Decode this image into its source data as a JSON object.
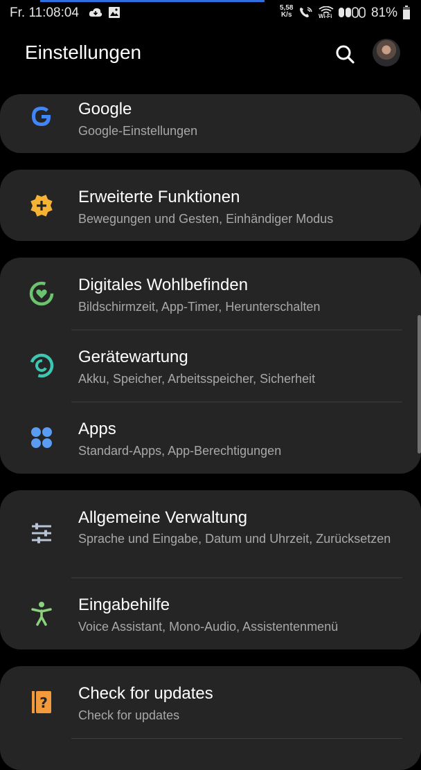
{
  "status_bar": {
    "time": "Fr. 11:08:04",
    "net_speed_value": "5,58",
    "net_speed_unit": "K/s",
    "wifi_label": "Wi-Fi",
    "battery": "81%"
  },
  "header": {
    "title": "Einstellungen"
  },
  "items": [
    {
      "title": "Google",
      "subtitle": "Google-Einstellungen",
      "icon": "google-icon",
      "color": "#4285f4"
    },
    {
      "title": "Erweiterte Funktionen",
      "subtitle": "Bewegungen und Gesten, Einhändiger Modus",
      "icon": "advanced-features-icon",
      "color": "#f6b235"
    },
    {
      "title": "Digitales Wohlbefinden",
      "subtitle": "Bildschirmzeit, App-Timer, Herunterschalten",
      "icon": "digital-wellbeing-icon",
      "color": "#6cc36f"
    },
    {
      "title": "Gerätewartung",
      "subtitle": "Akku, Speicher, Arbeitsspeicher, Sicherheit",
      "icon": "device-care-icon",
      "color": "#3ec7b0"
    },
    {
      "title": "Apps",
      "subtitle": "Standard-Apps, App-Berechtigungen",
      "icon": "apps-icon",
      "color": "#5a9cf2"
    },
    {
      "title": "Allgemeine Verwaltung",
      "subtitle": "Sprache und Eingabe, Datum und Uhrzeit, Zurücksetzen",
      "icon": "general-management-icon",
      "color": "#b8c4d6"
    },
    {
      "title": "Eingabehilfe",
      "subtitle": "Voice Assistant, Mono-Audio, Assistentenmenü",
      "icon": "accessibility-icon",
      "color": "#8cd27c"
    },
    {
      "title": "Check for updates",
      "subtitle": "Check for updates",
      "icon": "software-update-icon",
      "color": "#f39a3c"
    }
  ]
}
